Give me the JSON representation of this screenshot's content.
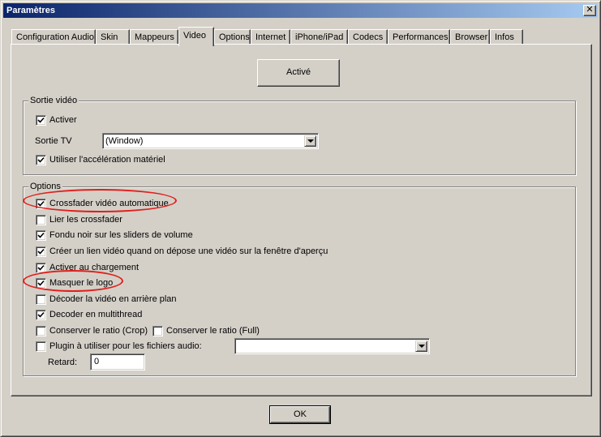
{
  "window": {
    "title": "Paramètres",
    "close_symbol": "✕"
  },
  "tabs": [
    {
      "label": "Configuration Audio",
      "active": false
    },
    {
      "label": "Skin",
      "active": false
    },
    {
      "label": "Mappeurs",
      "active": false
    },
    {
      "label": "Video",
      "active": true
    },
    {
      "label": "Options",
      "active": false
    },
    {
      "label": "Internet",
      "active": false
    },
    {
      "label": "iPhone/iPad",
      "active": false
    },
    {
      "label": "Codecs",
      "active": false
    },
    {
      "label": "Performances",
      "active": false
    },
    {
      "label": "Browser",
      "active": false
    },
    {
      "label": "Infos",
      "active": false
    }
  ],
  "activate_button": "Activé",
  "sortie_video": {
    "legend": "Sortie vidéo",
    "activer": {
      "label": "Activer",
      "checked": true
    },
    "sortie_tv_label": "Sortie TV",
    "sortie_tv_value": "(Window)",
    "accel": {
      "label": "Utiliser l'accélération matériel",
      "checked": true
    }
  },
  "options": {
    "legend": "Options",
    "items": [
      {
        "label": "Crossfader vidéo automatique",
        "checked": true
      },
      {
        "label": "Lier les crossfader",
        "checked": false
      },
      {
        "label": "Fondu noir sur les sliders de volume",
        "checked": true
      },
      {
        "label": "Créer un lien vidéo quand on dépose une vidéo sur la fenêtre d'aperçu",
        "checked": true
      },
      {
        "label": "Activer au chargement",
        "checked": true
      },
      {
        "label": "Masquer le logo",
        "checked": true
      },
      {
        "label": "Décoder la vidéo en arrière plan",
        "checked": false
      },
      {
        "label": "Decoder en multithread",
        "checked": true
      },
      {
        "label": "Conserver le ratio (Crop)",
        "checked": false
      },
      {
        "label": "Conserver le ratio (Full)",
        "checked": false
      },
      {
        "label": "Plugin à utiliser pour les fichiers audio:",
        "checked": false
      }
    ],
    "plugin_value": "",
    "retard_label": "Retard:",
    "retard_value": "0"
  },
  "ok_button": "OK",
  "colors": {
    "face": "#d4d0c8",
    "title_start": "#0a246a",
    "title_end": "#a6caf0",
    "annotation": "#e0201c"
  }
}
